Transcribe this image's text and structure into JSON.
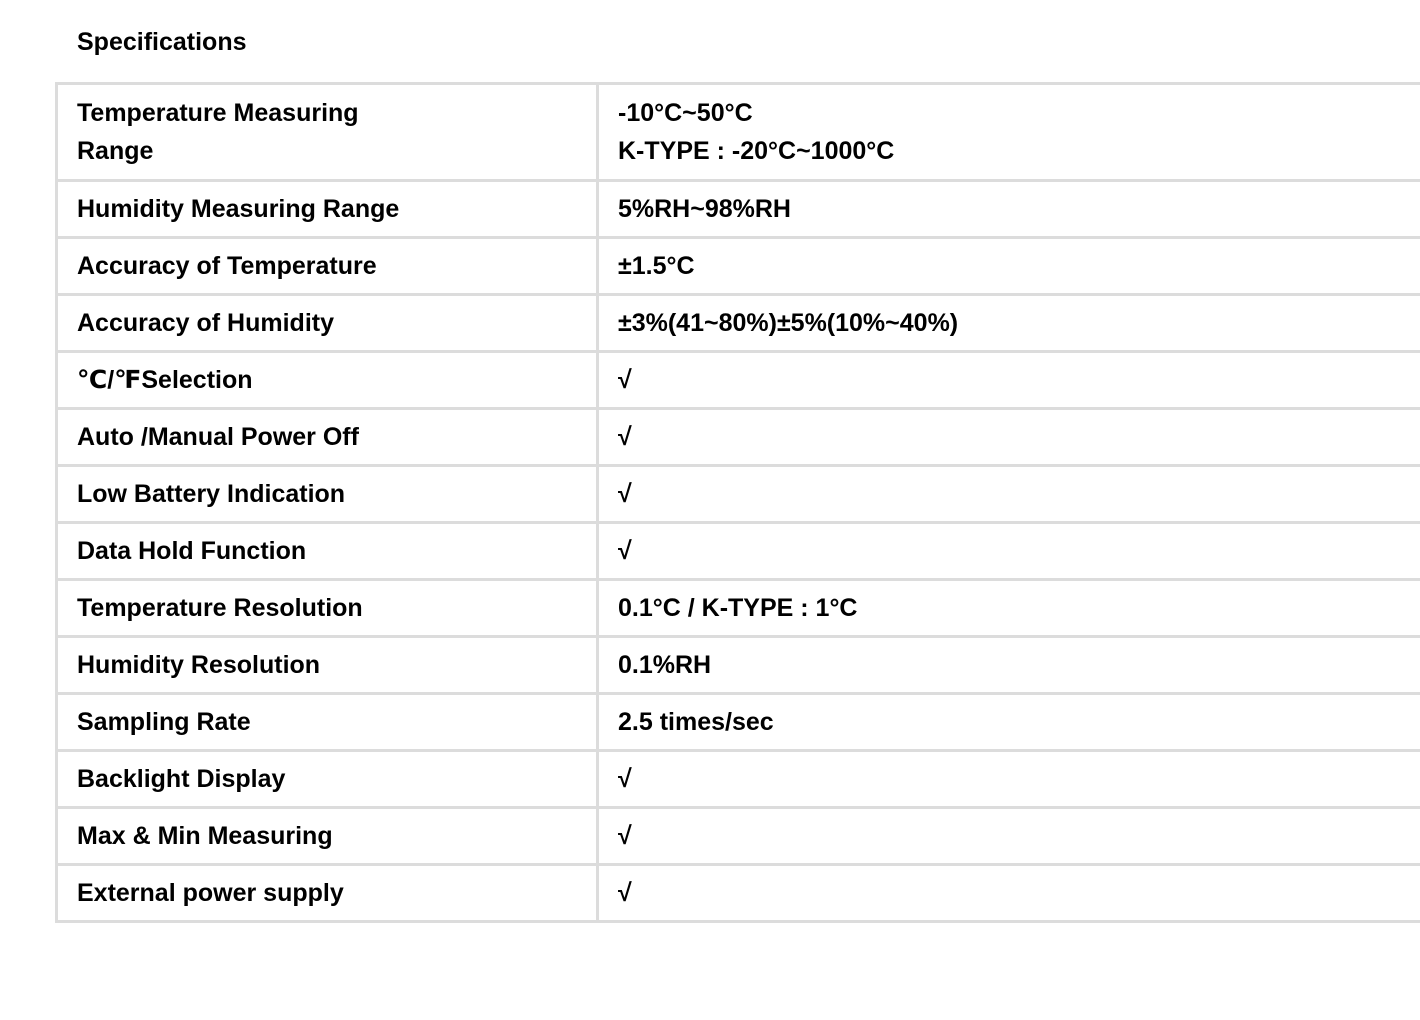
{
  "heading": "Specifications",
  "specs": [
    {
      "label_lines": [
        "Temperature Measuring",
        "Range"
      ],
      "value_lines": [
        "-10°C~50°C",
        "K-TYPE : -20°C~1000°C"
      ]
    },
    {
      "label": "Humidity Measuring Range",
      "value": "5%RH~98%RH"
    },
    {
      "label": "Accuracy of Temperature",
      "value": "±1.5°C"
    },
    {
      "label": "Accuracy of Humidity",
      "value": "±3%(41~80%)±5%(10%~40%)"
    },
    {
      "label": "℃/℉Selection",
      "value": "√"
    },
    {
      "label": "Auto /Manual Power Off",
      "value": "√"
    },
    {
      "label": "Low Battery Indication",
      "value": "√"
    },
    {
      "label": "Data Hold Function",
      "value": "√"
    },
    {
      "label": "Temperature Resolution",
      "value": "0.1°C / K-TYPE : 1°C"
    },
    {
      "label": "Humidity Resolution",
      "value": "0.1%RH"
    },
    {
      "label": "Sampling Rate",
      "value": "2.5 times/sec"
    },
    {
      "label": "Backlight Display",
      "value": "√"
    },
    {
      "label": "Max & Min Measuring",
      "value": "√"
    },
    {
      "label": "External power supply",
      "value": "√"
    }
  ]
}
